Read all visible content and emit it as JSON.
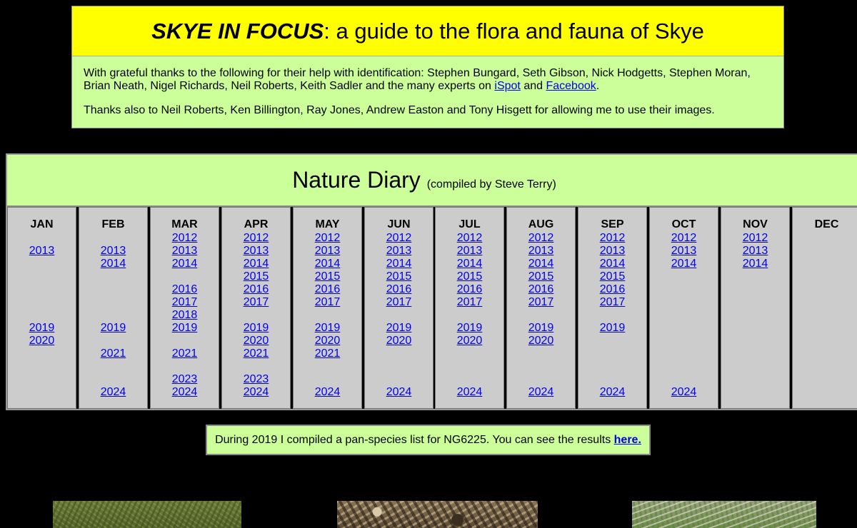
{
  "header": {
    "title_brand": "SKYE IN FOCUS",
    "title_rest": ": a guide to the flora and fauna of Skye",
    "thanks1_text": "With grateful thanks to the following for their help with identification: Stephen Bungard, Seth Gibson, Nick Hodgetts, Stephen Moran, Brian Neath, Nigel Richards, Neil Roberts, Keith Sadler and the many experts on ",
    "ispot_link": "iSpot",
    "and_text": " and ",
    "facebook_link": "Facebook",
    "period": ".",
    "thanks2_text": "Thanks also to Neil Roberts, Ken Billington, Ray Jones, Andrew Easton and Tony Hisgett for allowing me to use their images."
  },
  "diary": {
    "title": "Nature Diary",
    "subtitle": "(compiled by Steve Terry)",
    "months": [
      {
        "name": "JAN",
        "years": [
          [
            "2013",
            1
          ],
          [
            "2019",
            7
          ],
          [
            "2020",
            8
          ]
        ]
      },
      {
        "name": "FEB",
        "years": [
          [
            "2013",
            1
          ],
          [
            "2014",
            2
          ],
          [
            "2019",
            7
          ],
          [
            "2021",
            9
          ],
          [
            "2024",
            12
          ]
        ]
      },
      {
        "name": "MAR",
        "years": [
          [
            "2012",
            0
          ],
          [
            "2013",
            1
          ],
          [
            "2014",
            2
          ],
          [
            "2016",
            4
          ],
          [
            "2017",
            5
          ],
          [
            "2018",
            6
          ],
          [
            "2019",
            7
          ],
          [
            "2021",
            9
          ],
          [
            "2023",
            11
          ],
          [
            "2024",
            12
          ]
        ]
      },
      {
        "name": "APR",
        "years": [
          [
            "2012",
            0
          ],
          [
            "2013",
            1
          ],
          [
            "2014",
            2
          ],
          [
            "2015",
            3
          ],
          [
            "2016",
            4
          ],
          [
            "2017",
            5
          ],
          [
            "2019",
            7
          ],
          [
            "2020",
            8
          ],
          [
            "2021",
            9
          ],
          [
            "2023",
            11
          ],
          [
            "2024",
            12
          ]
        ]
      },
      {
        "name": "MAY",
        "years": [
          [
            "2012",
            0
          ],
          [
            "2013",
            1
          ],
          [
            "2014",
            2
          ],
          [
            "2015",
            3
          ],
          [
            "2016",
            4
          ],
          [
            "2017",
            5
          ],
          [
            "2019",
            7
          ],
          [
            "2020",
            8
          ],
          [
            "2021",
            9
          ],
          [
            "2024",
            12
          ]
        ]
      },
      {
        "name": "JUN",
        "years": [
          [
            "2012",
            0
          ],
          [
            "2013",
            1
          ],
          [
            "2014",
            2
          ],
          [
            "2015",
            3
          ],
          [
            "2016",
            4
          ],
          [
            "2017",
            5
          ],
          [
            "2019",
            7
          ],
          [
            "2020",
            8
          ],
          [
            "2024",
            12
          ]
        ]
      },
      {
        "name": "JUL",
        "years": [
          [
            "2012",
            0
          ],
          [
            "2013",
            1
          ],
          [
            "2014",
            2
          ],
          [
            "2015",
            3
          ],
          [
            "2016",
            4
          ],
          [
            "2017",
            5
          ],
          [
            "2019",
            7
          ],
          [
            "2020",
            8
          ],
          [
            "2024",
            12
          ]
        ]
      },
      {
        "name": "AUG",
        "years": [
          [
            "2012",
            0
          ],
          [
            "2013",
            1
          ],
          [
            "2014",
            2
          ],
          [
            "2015",
            3
          ],
          [
            "2016",
            4
          ],
          [
            "2017",
            5
          ],
          [
            "2019",
            7
          ],
          [
            "2020",
            8
          ],
          [
            "2024",
            12
          ]
        ]
      },
      {
        "name": "SEP",
        "years": [
          [
            "2012",
            0
          ],
          [
            "2013",
            1
          ],
          [
            "2014",
            2
          ],
          [
            "2015",
            3
          ],
          [
            "2016",
            4
          ],
          [
            "2017",
            5
          ],
          [
            "2019",
            7
          ],
          [
            "2024",
            12
          ]
        ]
      },
      {
        "name": "OCT",
        "years": [
          [
            "2012",
            0
          ],
          [
            "2013",
            1
          ],
          [
            "2014",
            2
          ],
          [
            "2024",
            12
          ]
        ]
      },
      {
        "name": "NOV",
        "years": [
          [
            "2012",
            0
          ],
          [
            "2013",
            1
          ],
          [
            "2014",
            2
          ]
        ]
      },
      {
        "name": "DEC",
        "years": []
      }
    ]
  },
  "note": {
    "text": "During 2019 I compiled a pan-species list for NG6225. You can see the results ",
    "link": "here."
  }
}
